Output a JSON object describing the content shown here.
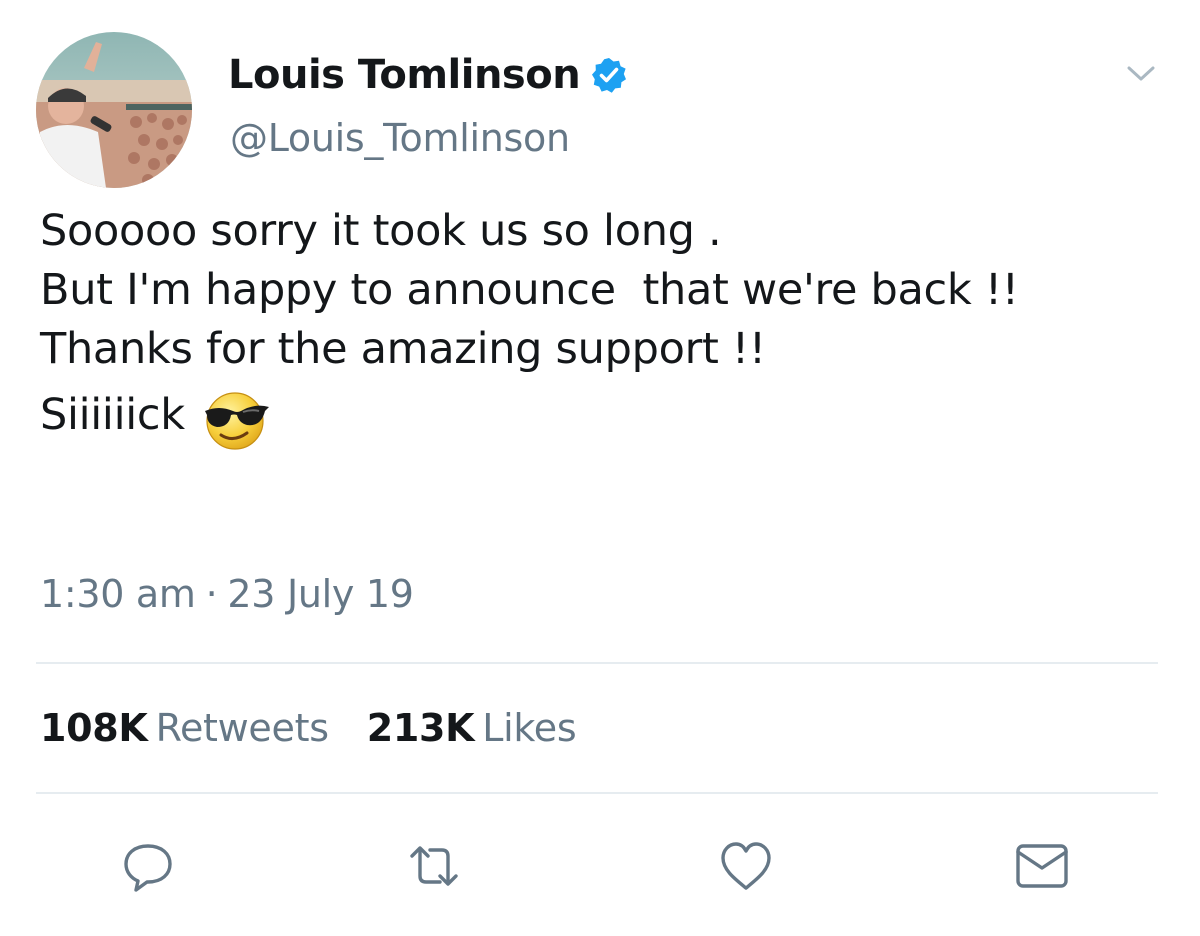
{
  "tweet": {
    "author": {
      "display_name": "Louis Tomlinson",
      "handle": "@Louis_Tomlinson",
      "verified": true
    },
    "body_lines": [
      "Sooooo sorry it took us so long .",
      "But I'm happy to announce  that we're back !!",
      "Thanks for the amazing support !!",
      "Siiiiiick"
    ],
    "emoji": "smiling-face-with-sunglasses",
    "time": "1:30 am",
    "separator": "·",
    "date": "23 July 19",
    "stats": {
      "retweets_count": "108K",
      "retweets_label": "Retweets",
      "likes_count": "213K",
      "likes_label": "Likes"
    },
    "actions": [
      "reply-icon",
      "retweet-icon",
      "like-icon",
      "message-icon"
    ]
  },
  "colors": {
    "text_primary": "#14171a",
    "text_secondary": "#657786",
    "verified_blue": "#1da1f2",
    "divider": "#e6ecf0"
  }
}
